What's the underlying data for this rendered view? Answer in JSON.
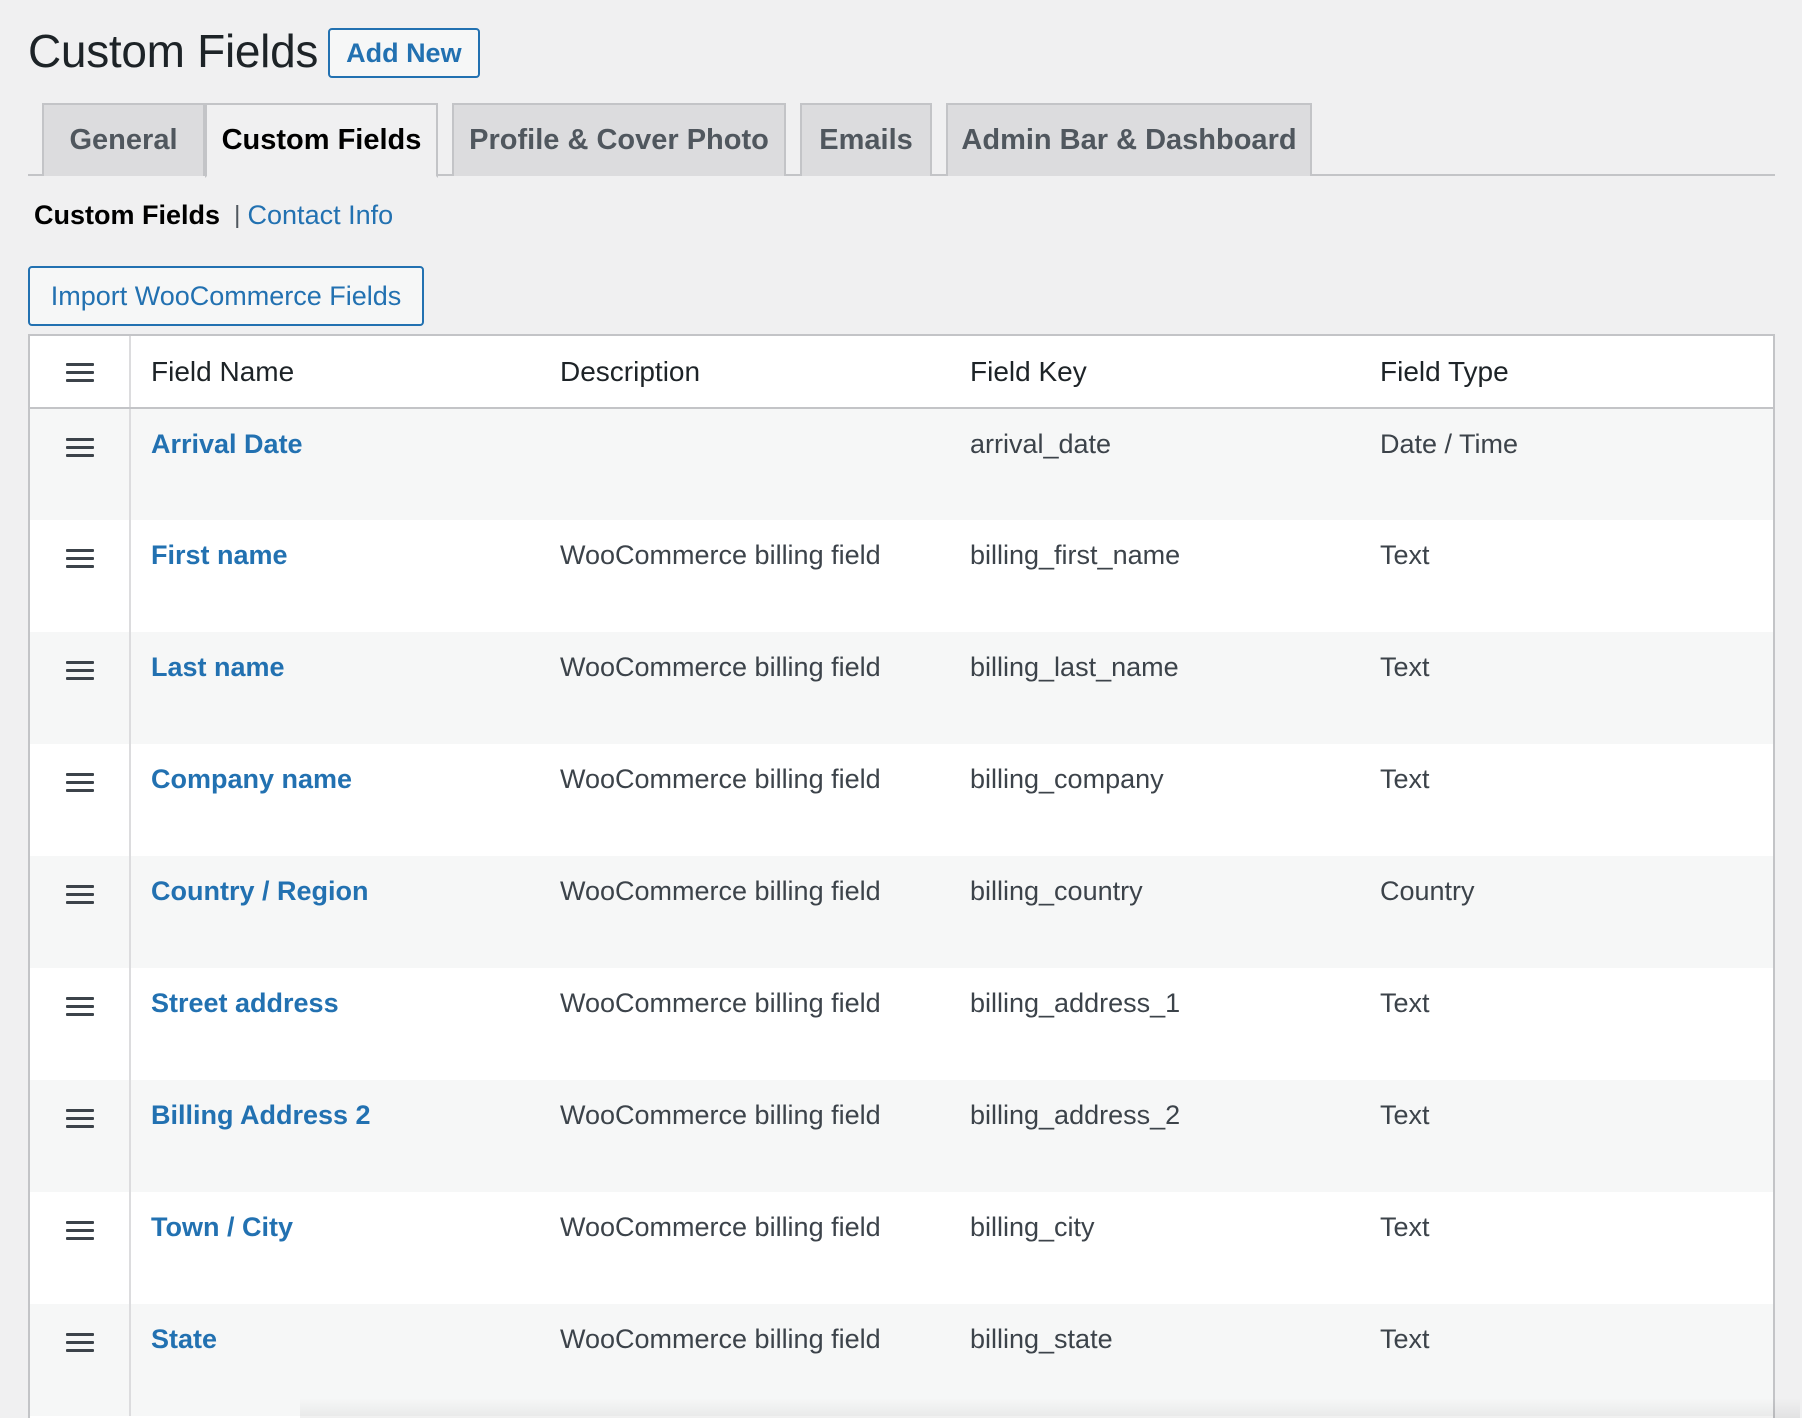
{
  "header": {
    "title": "Custom Fields",
    "add_new_label": "Add New"
  },
  "tabs": [
    {
      "label": "General",
      "active": false
    },
    {
      "label": "Custom Fields",
      "active": true
    },
    {
      "label": "Profile & Cover Photo",
      "active": false
    },
    {
      "label": "Emails",
      "active": false
    },
    {
      "label": "Admin Bar & Dashboard",
      "active": false
    }
  ],
  "subnav": {
    "current": "Custom Fields",
    "separator": "|",
    "link": "Contact Info"
  },
  "import_button_label": "Import WooCommerce Fields",
  "table": {
    "handle_icon": "menu-icon",
    "columns": [
      "Field Name",
      "Description",
      "Field Key",
      "Field Type"
    ],
    "rows": [
      {
        "name": "Arrival Date",
        "description": "",
        "key": "arrival_date",
        "type": "Date / Time"
      },
      {
        "name": "First name",
        "description": "WooCommerce billing field",
        "key": "billing_first_name",
        "type": "Text"
      },
      {
        "name": "Last name",
        "description": "WooCommerce billing field",
        "key": "billing_last_name",
        "type": "Text"
      },
      {
        "name": "Company name",
        "description": "WooCommerce billing field",
        "key": "billing_company",
        "type": "Text"
      },
      {
        "name": "Country / Region",
        "description": "WooCommerce billing field",
        "key": "billing_country",
        "type": "Country"
      },
      {
        "name": "Street address",
        "description": "WooCommerce billing field",
        "key": "billing_address_1",
        "type": "Text"
      },
      {
        "name": "Billing Address 2",
        "description": "WooCommerce billing field",
        "key": "billing_address_2",
        "type": "Text"
      },
      {
        "name": "Town / City",
        "description": "WooCommerce billing field",
        "key": "billing_city",
        "type": "Text"
      },
      {
        "name": "State",
        "description": "WooCommerce billing field",
        "key": "billing_state",
        "type": "Text"
      }
    ]
  },
  "colors": {
    "link": "#2271b1",
    "background": "#f0f0f1",
    "border": "#c3c4c7"
  }
}
